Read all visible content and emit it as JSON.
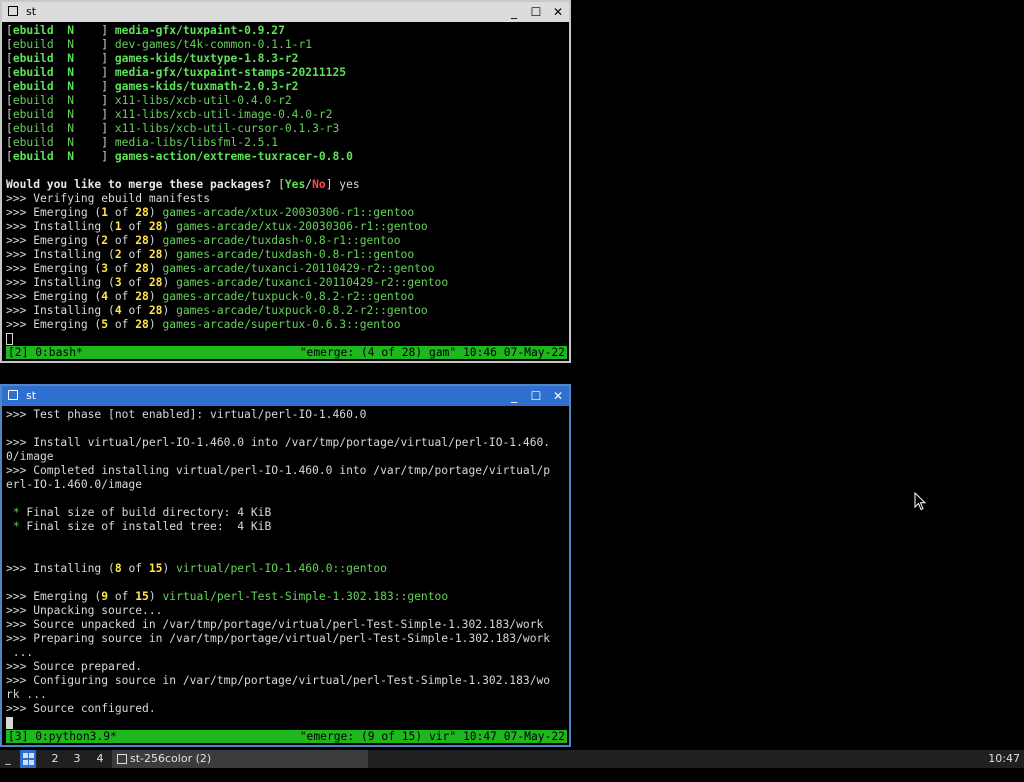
{
  "window1": {
    "title": "st",
    "lines": [
      [
        {
          "t": "["
        },
        {
          "t": "ebuild  N    ",
          "c": "gb"
        },
        {
          "t": "] "
        },
        {
          "t": "media-gfx/tuxpaint-0.9.27",
          "c": "gb"
        }
      ],
      [
        {
          "t": "["
        },
        {
          "t": "ebuild  N    ",
          "c": "g"
        },
        {
          "t": "] "
        },
        {
          "t": "dev-games/t4k-common-0.1.1-r1",
          "c": "g"
        }
      ],
      [
        {
          "t": "["
        },
        {
          "t": "ebuild  N    ",
          "c": "gb"
        },
        {
          "t": "] "
        },
        {
          "t": "games-kids/tuxtype-1.8.3-r2",
          "c": "gb"
        }
      ],
      [
        {
          "t": "["
        },
        {
          "t": "ebuild  N    ",
          "c": "gb"
        },
        {
          "t": "] "
        },
        {
          "t": "media-gfx/tuxpaint-stamps-20211125",
          "c": "gb"
        }
      ],
      [
        {
          "t": "["
        },
        {
          "t": "ebuild  N    ",
          "c": "gb"
        },
        {
          "t": "] "
        },
        {
          "t": "games-kids/tuxmath-2.0.3-r2",
          "c": "gb"
        }
      ],
      [
        {
          "t": "["
        },
        {
          "t": "ebuild  N    ",
          "c": "g"
        },
        {
          "t": "] "
        },
        {
          "t": "x11-libs/xcb-util-0.4.0-r2",
          "c": "g"
        }
      ],
      [
        {
          "t": "["
        },
        {
          "t": "ebuild  N    ",
          "c": "g"
        },
        {
          "t": "] "
        },
        {
          "t": "x11-libs/xcb-util-image-0.4.0-r2",
          "c": "g"
        }
      ],
      [
        {
          "t": "["
        },
        {
          "t": "ebuild  N    ",
          "c": "g"
        },
        {
          "t": "] "
        },
        {
          "t": "x11-libs/xcb-util-cursor-0.1.3-r3",
          "c": "g"
        }
      ],
      [
        {
          "t": "["
        },
        {
          "t": "ebuild  N    ",
          "c": "g"
        },
        {
          "t": "] "
        },
        {
          "t": "media-libs/libsfml-2.5.1",
          "c": "g"
        }
      ],
      [
        {
          "t": "["
        },
        {
          "t": "ebuild  N    ",
          "c": "gb"
        },
        {
          "t": "] "
        },
        {
          "t": "games-action/extreme-tuxracer-0.8.0",
          "c": "gb"
        }
      ],
      [],
      [
        {
          "t": "Would you like to merge these packages? ",
          "c": "b"
        },
        {
          "t": "["
        },
        {
          "t": "Yes",
          "c": "gb"
        },
        {
          "t": "/"
        },
        {
          "t": "No",
          "c": "r"
        },
        {
          "t": "] yes"
        }
      ],
      [
        {
          "t": ">>> Verifying ebuild manifests"
        }
      ],
      [
        {
          "t": ">>> Emerging ("
        },
        {
          "t": "1",
          "c": "y"
        },
        {
          "t": " of "
        },
        {
          "t": "28",
          "c": "y"
        },
        {
          "t": ") "
        },
        {
          "t": "games-arcade/xtux-20030306-r1::gentoo",
          "c": "g"
        }
      ],
      [
        {
          "t": ">>> Installing ("
        },
        {
          "t": "1",
          "c": "y"
        },
        {
          "t": " of "
        },
        {
          "t": "28",
          "c": "y"
        },
        {
          "t": ") "
        },
        {
          "t": "games-arcade/xtux-20030306-r1::gentoo",
          "c": "g"
        }
      ],
      [
        {
          "t": ">>> Emerging ("
        },
        {
          "t": "2",
          "c": "y"
        },
        {
          "t": " of "
        },
        {
          "t": "28",
          "c": "y"
        },
        {
          "t": ") "
        },
        {
          "t": "games-arcade/tuxdash-0.8-r1::gentoo",
          "c": "g"
        }
      ],
      [
        {
          "t": ">>> Installing ("
        },
        {
          "t": "2",
          "c": "y"
        },
        {
          "t": " of "
        },
        {
          "t": "28",
          "c": "y"
        },
        {
          "t": ") "
        },
        {
          "t": "games-arcade/tuxdash-0.8-r1::gentoo",
          "c": "g"
        }
      ],
      [
        {
          "t": ">>> Emerging ("
        },
        {
          "t": "3",
          "c": "y"
        },
        {
          "t": " of "
        },
        {
          "t": "28",
          "c": "y"
        },
        {
          "t": ") "
        },
        {
          "t": "games-arcade/tuxanci-20110429-r2::gentoo",
          "c": "g"
        }
      ],
      [
        {
          "t": ">>> Installing ("
        },
        {
          "t": "3",
          "c": "y"
        },
        {
          "t": " of "
        },
        {
          "t": "28",
          "c": "y"
        },
        {
          "t": ") "
        },
        {
          "t": "games-arcade/tuxanci-20110429-r2::gentoo",
          "c": "g"
        }
      ],
      [
        {
          "t": ">>> Emerging ("
        },
        {
          "t": "4",
          "c": "y"
        },
        {
          "t": " of "
        },
        {
          "t": "28",
          "c": "y"
        },
        {
          "t": ") "
        },
        {
          "t": "games-arcade/tuxpuck-0.8.2-r2::gentoo",
          "c": "g"
        }
      ],
      [
        {
          "t": ">>> Installing ("
        },
        {
          "t": "4",
          "c": "y"
        },
        {
          "t": " of "
        },
        {
          "t": "28",
          "c": "y"
        },
        {
          "t": ") "
        },
        {
          "t": "games-arcade/tuxpuck-0.8.2-r2::gentoo",
          "c": "g"
        }
      ],
      [
        {
          "t": ">>> Emerging ("
        },
        {
          "t": "5",
          "c": "y"
        },
        {
          "t": " of "
        },
        {
          "t": "28",
          "c": "y"
        },
        {
          "t": ") "
        },
        {
          "t": "games-arcade/supertux-0.6.3::gentoo",
          "c": "g"
        }
      ]
    ],
    "status_left": "[2] 0:bash*",
    "status_right": "\"emerge: (4 of 28) gam\" 10:46 07-May-22"
  },
  "window2": {
    "title": "st",
    "lines": [
      [
        {
          "t": ">>> Test phase [not enabled]: virtual/perl-IO-1.460.0"
        }
      ],
      [],
      [
        {
          "t": ">>> Install virtual/perl-IO-1.460.0 into /var/tmp/portage/virtual/perl-IO-1.460."
        }
      ],
      [
        {
          "t": "0/image"
        }
      ],
      [
        {
          "t": ">>> Completed installing virtual/perl-IO-1.460.0 into /var/tmp/portage/virtual/p"
        }
      ],
      [
        {
          "t": "erl-IO-1.460.0/image"
        }
      ],
      [],
      [
        {
          "t": " "
        },
        {
          "t": "*",
          "c": "g"
        },
        {
          "t": " Final size of build directory: 4 KiB"
        }
      ],
      [
        {
          "t": " "
        },
        {
          "t": "*",
          "c": "g"
        },
        {
          "t": " Final size of installed tree:  4 KiB"
        }
      ],
      [],
      [],
      [
        {
          "t": ">>> Installing ("
        },
        {
          "t": "8",
          "c": "y"
        },
        {
          "t": " of "
        },
        {
          "t": "15",
          "c": "y"
        },
        {
          "t": ") "
        },
        {
          "t": "virtual/perl-IO-1.460.0::gentoo",
          "c": "g"
        }
      ],
      [],
      [
        {
          "t": ">>> Emerging ("
        },
        {
          "t": "9",
          "c": "y"
        },
        {
          "t": " of "
        },
        {
          "t": "15",
          "c": "y"
        },
        {
          "t": ") "
        },
        {
          "t": "virtual/perl-Test-Simple-1.302.183::gentoo",
          "c": "g"
        }
      ],
      [
        {
          "t": ">>> Unpacking source..."
        }
      ],
      [
        {
          "t": ">>> Source unpacked in /var/tmp/portage/virtual/perl-Test-Simple-1.302.183/work"
        }
      ],
      [
        {
          "t": ">>> Preparing source in /var/tmp/portage/virtual/perl-Test-Simple-1.302.183/work"
        }
      ],
      [
        {
          "t": " ..."
        }
      ],
      [
        {
          "t": ">>> Source prepared."
        }
      ],
      [
        {
          "t": ">>> Configuring source in /var/tmp/portage/virtual/perl-Test-Simple-1.302.183/wo"
        }
      ],
      [
        {
          "t": "rk ..."
        }
      ],
      [
        {
          "t": ">>> Source configured."
        }
      ]
    ],
    "status_left": "[3] 0:python3.9*",
    "status_right": "\"emerge: (9 of 15) vir\" 10:47 07-May-22"
  },
  "taskbar": {
    "layout_symbol": "_",
    "tags": [
      "2",
      "3",
      "4"
    ],
    "task_label": "st-256color (2)",
    "clock": "10:47"
  }
}
